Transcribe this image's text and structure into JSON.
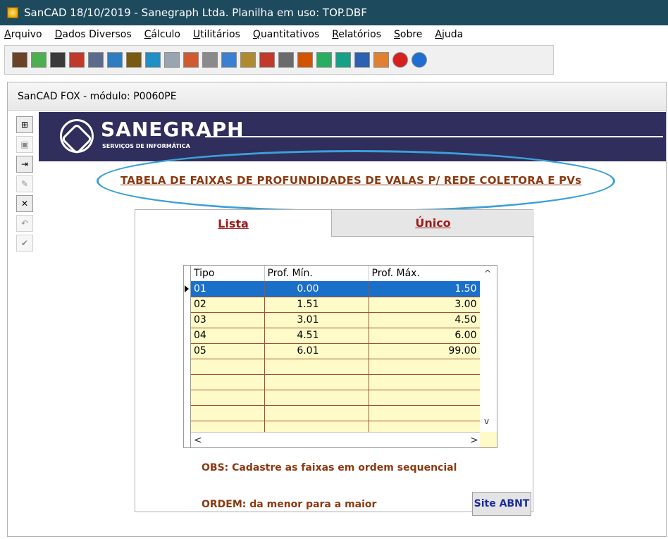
{
  "window": {
    "title": "SanCAD 18/10/2019 - Sanegraph Ltda. Planilha em uso: TOP.DBF"
  },
  "menu": [
    "Arquivo",
    "Dados Diversos",
    "Cálculo",
    "Utilitários",
    "Quantitativos",
    "Relatórios",
    "Sobre",
    "Ajuda"
  ],
  "toolbar": {
    "icons": [
      "import-icon",
      "download-icon",
      "list-icon",
      "printer-icon",
      "edit-icon",
      "search-icon",
      "binoculars-icon",
      "calculator-icon",
      "document-icon",
      "print-preview-icon",
      "print-icon",
      "edit-note-icon",
      "tools-icon",
      "chart-icon",
      "stamp-icon",
      "export-icon",
      "export-icon",
      "export-icon",
      "save-icon",
      "users-icon",
      "help-red-icon",
      "help-blue-icon"
    ],
    "colors": [
      "#6b4226",
      "#4caf50",
      "#3a3a3a",
      "#c0392b",
      "#5a6b8c",
      "#2f7dc1",
      "#7a5a10",
      "#1f8fc6",
      "#9aa3b0",
      "#d05a2f",
      "#8a8a8a",
      "#3b7fd1",
      "#b08a2e",
      "#c0392b",
      "#6b6b6b",
      "#d35400",
      "#27ae60",
      "#16a085",
      "#2c60b0",
      "#e08030",
      "#d62020",
      "#1e6fd0"
    ]
  },
  "inner": {
    "title": "SanCAD FOX - módulo: P0060PE"
  },
  "vtoolbar": {
    "buttons": [
      {
        "name": "add-record-icon",
        "glyph": "⊞",
        "disabled": false
      },
      {
        "name": "save-record-icon",
        "glyph": "▣",
        "disabled": true
      },
      {
        "name": "exit-icon",
        "glyph": "⇥",
        "disabled": false
      },
      {
        "name": "edit-record-icon",
        "glyph": "✎",
        "disabled": true
      },
      {
        "name": "delete-record-icon",
        "glyph": "✕",
        "disabled": false
      },
      {
        "name": "undo-icon",
        "glyph": "↶",
        "disabled": true
      },
      {
        "name": "confirm-icon",
        "glyph": "✔",
        "disabled": true
      }
    ]
  },
  "banner": {
    "brand": "SANEGRAPH",
    "subtitle": "SERVIÇOS DE INFORMÁTICA"
  },
  "heading": "TABELA DE FAIXAS DE PROFUNDIDADES DE VALAS P/ REDE COLETORA E PVs",
  "tabs": {
    "lista": "Lista",
    "unico": "Único"
  },
  "grid": {
    "columns": [
      "Tipo",
      "Prof. Mín.",
      "Prof. Máx."
    ],
    "rows": [
      [
        "01",
        "0.00",
        "1.50"
      ],
      [
        "02",
        "1.51",
        "3.00"
      ],
      [
        "03",
        "3.01",
        "4.50"
      ],
      [
        "04",
        "4.51",
        "6.00"
      ],
      [
        "05",
        "6.01",
        "99.00"
      ],
      [
        "",
        "",
        ""
      ],
      [
        "",
        "",
        ""
      ],
      [
        "",
        "",
        ""
      ],
      [
        "",
        "",
        ""
      ],
      [
        "",
        "",
        ""
      ]
    ],
    "selected_row": 0
  },
  "obs": {
    "line1": "OBS: Cadastre as faixas em ordem sequencial",
    "line2": "ORDEM: da menor para a maior"
  },
  "buttons": {
    "site_abnt": "Site ABNT"
  },
  "scroll": {
    "up": "^",
    "down": "v",
    "left": "<",
    "right": ">"
  }
}
